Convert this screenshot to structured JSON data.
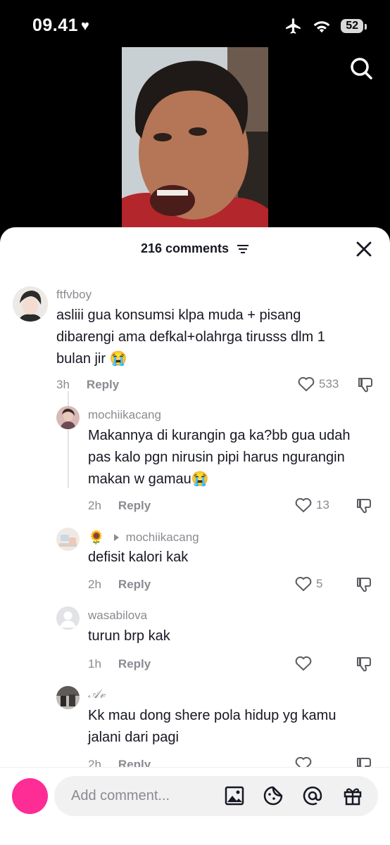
{
  "status": {
    "time": "09.41",
    "battery": "52"
  },
  "sheet": {
    "comment_count": "216 comments"
  },
  "comments": [
    {
      "user": "ftfvboy",
      "text_lines": [
        "asliii gua konsumsi klpa muda + pisang",
        "dibarengi ama defkal+olahrga tirusss dlm 1",
        "bulan jir 😭"
      ],
      "time": "3h",
      "reply": "Reply",
      "likes": "533"
    },
    {
      "user": "mochiikacang",
      "text_lines": [
        "Makannya di kurangin ga ka?bb gua udah",
        "pas kalo pgn nirusin pipi harus ngurangin",
        "makan w gamau😭"
      ],
      "time": "2h",
      "reply": "Reply",
      "likes": "13"
    },
    {
      "user_prefix": "🌻",
      "reply_to": "mochiikacang",
      "text_lines": [
        "defisit kalori kak"
      ],
      "time": "2h",
      "reply": "Reply",
      "likes": "5"
    },
    {
      "user": "wasabilova",
      "text_lines": [
        "turun brp kak"
      ],
      "time": "1h",
      "reply": "Reply",
      "likes": ""
    },
    {
      "user": "𝒜𝓋",
      "text_lines": [
        "Kk mau dong shere pola hidup yg kamu",
        "jalani dari pagi"
      ],
      "time": "2h",
      "reply": "Reply",
      "likes": ""
    }
  ],
  "input": {
    "placeholder": "Add comment..."
  },
  "icons": [
    "heart-icon",
    "airplane-icon",
    "wifi-icon",
    "search-icon",
    "filter-icon",
    "close-icon",
    "like-icon",
    "dislike-icon",
    "image-icon",
    "sticker-icon",
    "mention-icon",
    "gift-icon"
  ]
}
